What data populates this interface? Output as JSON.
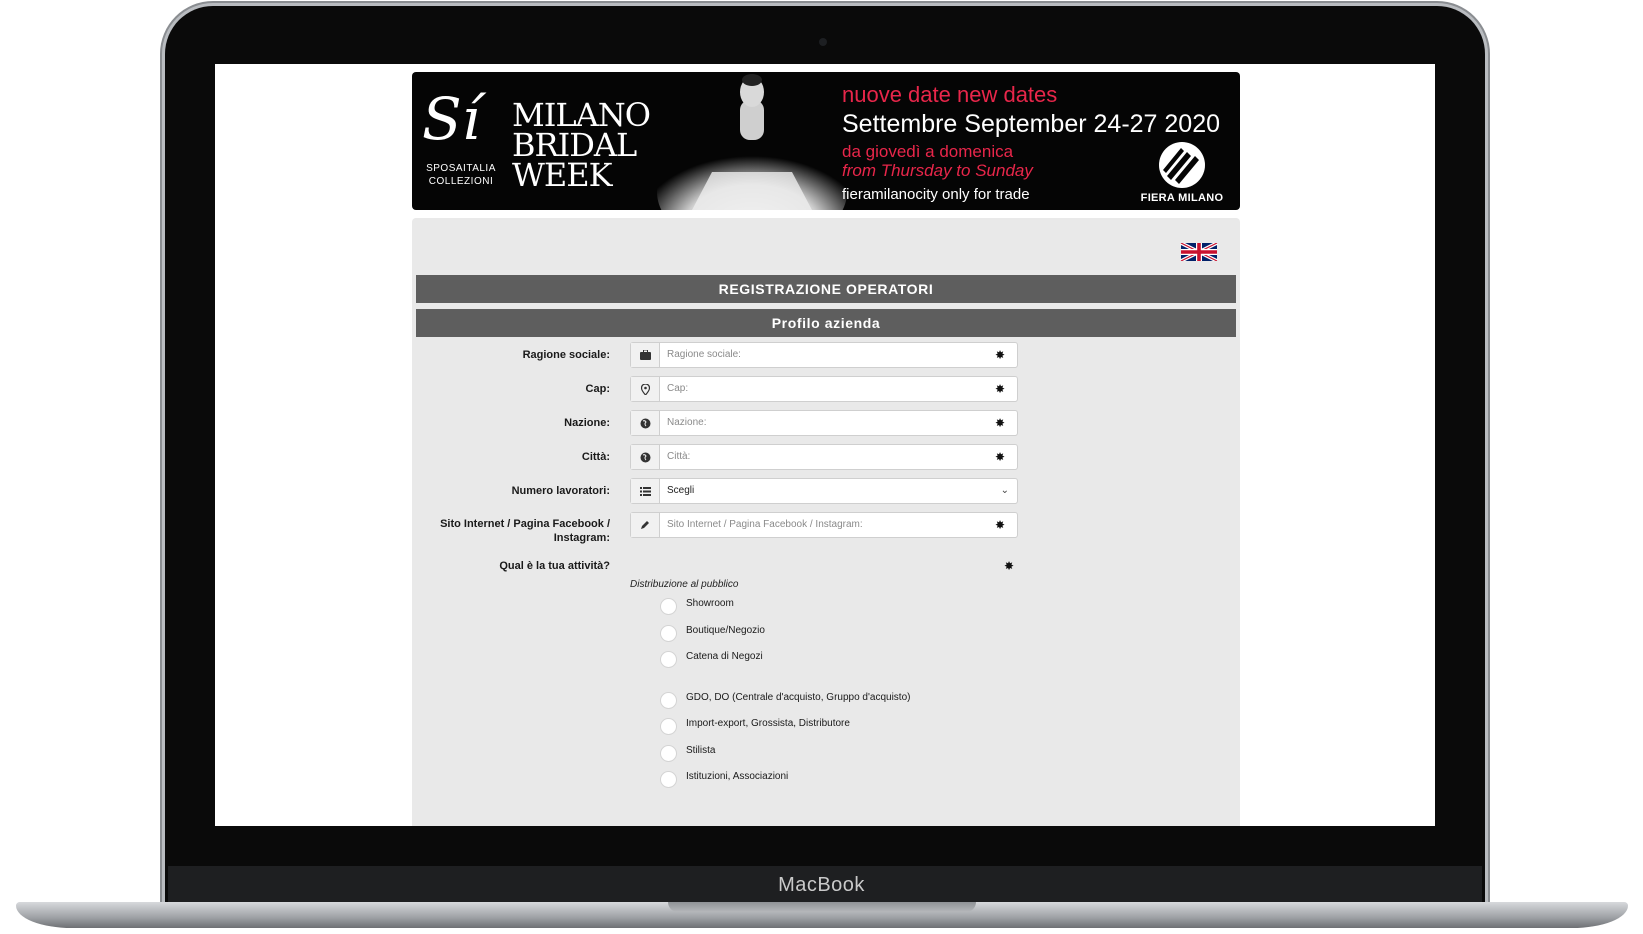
{
  "device": {
    "brand": "MacBook"
  },
  "banner": {
    "logo_mark": "Sí",
    "logo_sub_1": "SPOSAITALIA",
    "logo_sub_2": "COLLEZIONI",
    "event_line1": "MILANO",
    "event_line2": "BRIDAL",
    "event_line3": "WEEK",
    "dates_note": "nuove date new dates",
    "dates_main": "Settembre September 24-27 2020",
    "days_it": "da giovedì a domenica",
    "days_en": "from Thursday to Sunday",
    "venue": "fieramilanocity  only for trade",
    "organizer": "FIERA MILANO",
    "accent_color": "#e8264a"
  },
  "language": {
    "icon": "uk-flag-icon"
  },
  "header": {
    "title": "REGISTRAZIONE OPERATORI"
  },
  "section": {
    "title": "Profilo azienda"
  },
  "fields": [
    {
      "label": "Ragione sociale:",
      "placeholder": "Ragione sociale:",
      "icon": "briefcase-icon",
      "required": "✸"
    },
    {
      "label": "Cap:",
      "placeholder": "Cap:",
      "icon": "map-marker-icon",
      "required": "✸"
    },
    {
      "label": "Nazione:",
      "placeholder": "Nazione:",
      "icon": "globe-icon",
      "required": "✸"
    },
    {
      "label": "Città:",
      "placeholder": "Città:",
      "icon": "globe-icon",
      "required": "✸"
    },
    {
      "label": "Numero lavoratori:",
      "value": "Scegli",
      "icon": "list-icon"
    },
    {
      "label_line1": "Sito Internet / Pagina Facebook /",
      "label_line2": "Instagram:",
      "placeholder": "Sito Internet / Pagina Facebook / Instagram:",
      "icon": "pencil-icon",
      "required": "✸"
    }
  ],
  "activity": {
    "question": "Qual è la tua attività?",
    "required": "✸",
    "group": "Distribuzione al pubblico",
    "options": [
      "Showroom",
      "Boutique/Negozio",
      "Catena di Negozi",
      "GDO, DO (Centrale d'acquisto, Gruppo d'acquisto)",
      "Import-export, Grossista, Distributore",
      "Stilista",
      "Istituzioni, Associazioni"
    ]
  }
}
